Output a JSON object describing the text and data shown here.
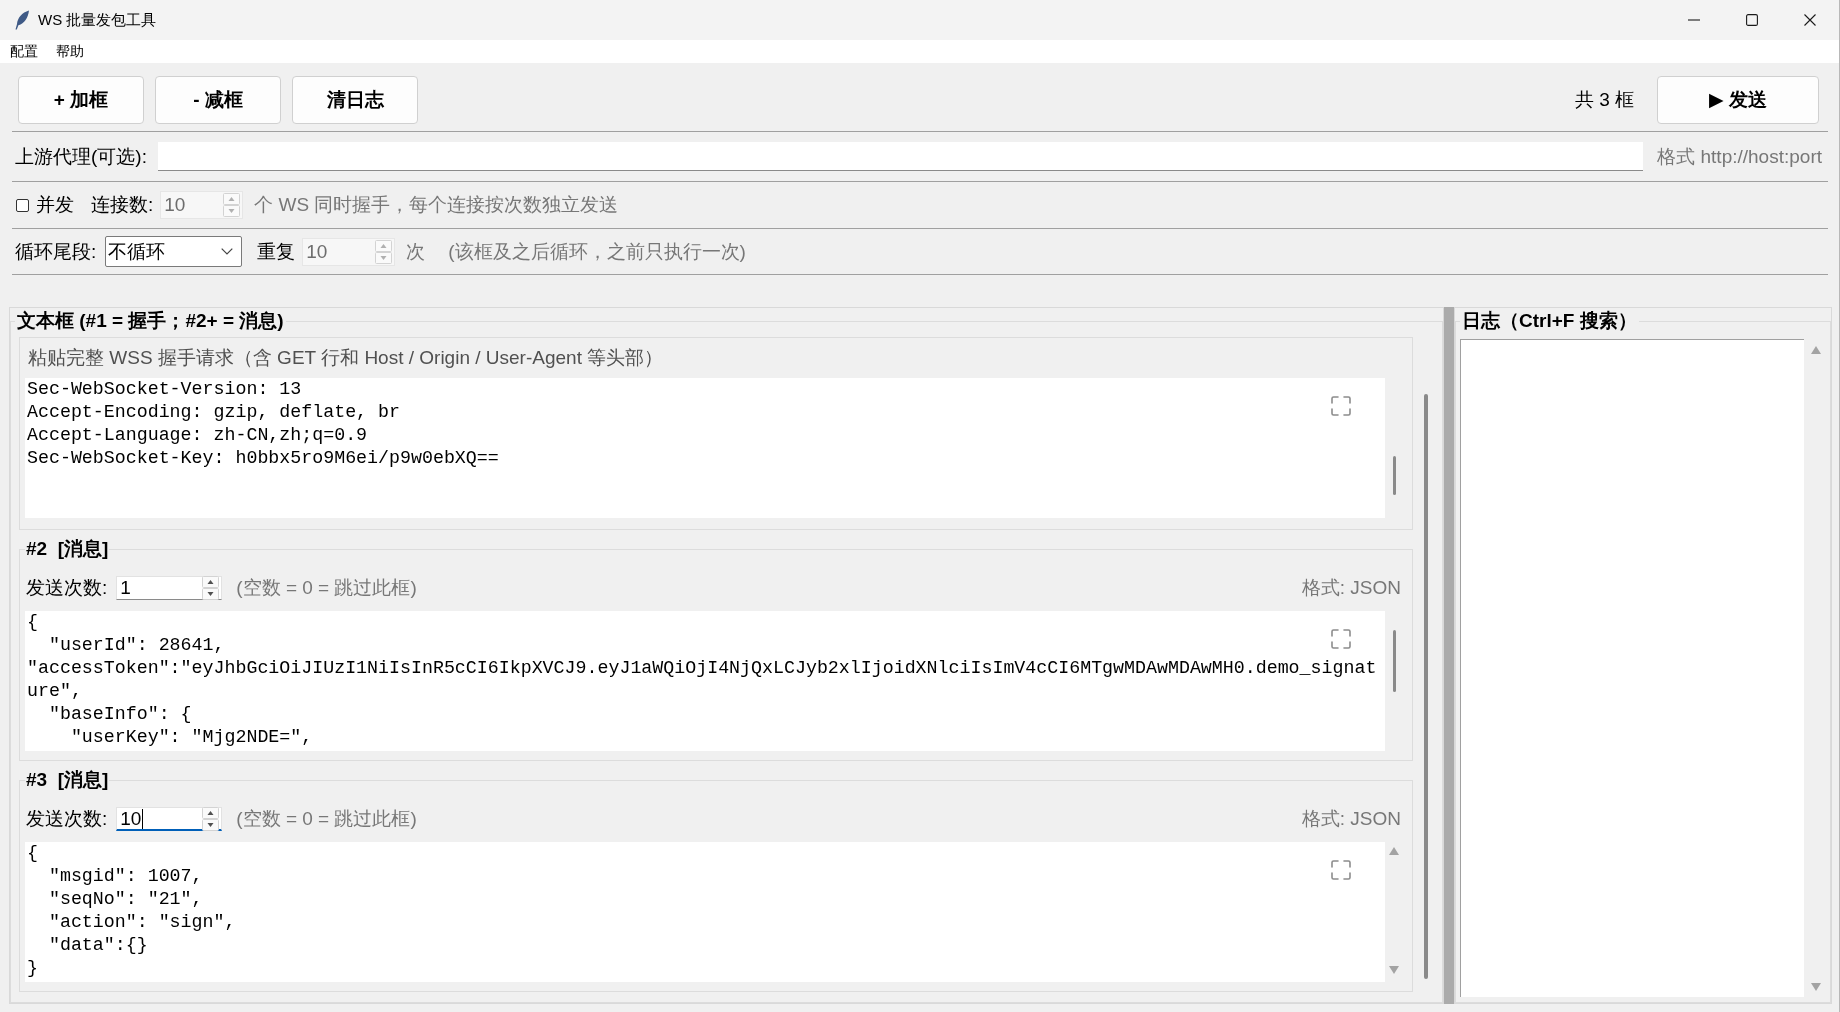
{
  "window": {
    "title": "WS 批量发包工具"
  },
  "menu": [
    "配置",
    "帮助"
  ],
  "toolbar": {
    "buttons": [
      "+ 加框",
      "- 减框",
      "清日志"
    ],
    "frame_count": "共 3 框",
    "send_button": "▶ 发送"
  },
  "proxy": {
    "label": "上游代理(可选):",
    "hint": "格式 http://host:port"
  },
  "concurrency": {
    "checkbox": {
      "label": "并发",
      "checked": false
    },
    "connections": {
      "label": "连接数:",
      "value": "10",
      "disabled": true
    },
    "note": "个 WS 同时握手，每个连接按次数独立发送"
  },
  "loop": {
    "label": "循环尾段:",
    "dropdown": {
      "value": "不循环"
    },
    "repeat": {
      "label": "重复",
      "value": "10",
      "disabled": true
    },
    "unit": "次",
    "note": "(该框及之后循环，之前只执行一次)"
  },
  "editor_panel": {
    "title": "文本框 (#1 = 握手；#2+ = 消息)",
    "frames": [
      {
        "kind": "handshake",
        "hint": "粘贴完整 WSS 握手请求（含 GET 行和 Host / Origin / User-Agent 等头部）",
        "text": "Sec-WebSocket-Version: 13\nAccept-Encoding: gzip, deflate, br\nAccept-Language: zh-CN,zh;q=0.9\nSec-WebSocket-Key: h0bbx5ro9M6ei/p9w0ebXQ=="
      },
      {
        "kind": "message",
        "title": "#2  [消息]",
        "count": {
          "label": "发送次数:",
          "value": "1",
          "focused": false
        },
        "count_hint": "(空数 = 0 = 跳过此框)",
        "format": "格式: JSON",
        "text": "{\n  \"userId\": 28641,\n\"accessToken\":\"eyJhbGciOiJIUzI1NiIsInR5cCI6IkpXVCJ9.eyJ1aWQiOjI4NjQxLCJyb2xlIjoidXNlciIsImV4cCI6MTgwMDAwMDAwMH0.demo_signat\nure\",\n  \"baseInfo\": {\n    \"userKey\": \"Mjg2NDE=\","
      },
      {
        "kind": "message",
        "title": "#3  [消息]",
        "count": {
          "label": "发送次数:",
          "value": "10",
          "focused": true
        },
        "count_hint": "(空数 = 0 = 跳过此框)",
        "format": "格式: JSON",
        "text": "{\n  \"msgid\": 1007,\n  \"seqNo\": \"21\",\n  \"action\": \"sign\",\n  \"data\":{}\n}"
      }
    ]
  },
  "log_panel": {
    "title": "日志（Ctrl+F 搜索）"
  }
}
